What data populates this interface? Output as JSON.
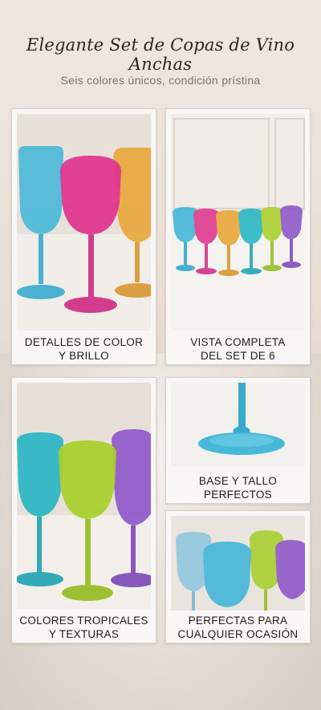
{
  "header": {
    "title": "Elegante Set de Copas de Vino Anchas",
    "subtitle": "Seis colores únicos, condición prístina"
  },
  "cards": [
    {
      "caption_line1": "DETALLES DE COLOR",
      "caption_line2": "Y BRILLO"
    },
    {
      "caption_line1": "VISTA COMPLETA",
      "caption_line2": "DEL SET DE 6"
    },
    {
      "caption_line1": "COLORES TROPICALES",
      "caption_line2": "Y TEXTURAS"
    },
    {
      "caption_line1": "BASE Y TALLO",
      "caption_line2": "PERFECTOS"
    },
    {
      "caption_line1": "PERFECTAS PARA",
      "caption_line2": "CUALQUIER OCASIÓN"
    }
  ],
  "colors": {
    "blue": "#3fb6d8",
    "pink": "#e0338f",
    "amber": "#e8a533",
    "teal": "#25b5c2",
    "lime": "#a8cf2a",
    "purple": "#8d55c9"
  }
}
